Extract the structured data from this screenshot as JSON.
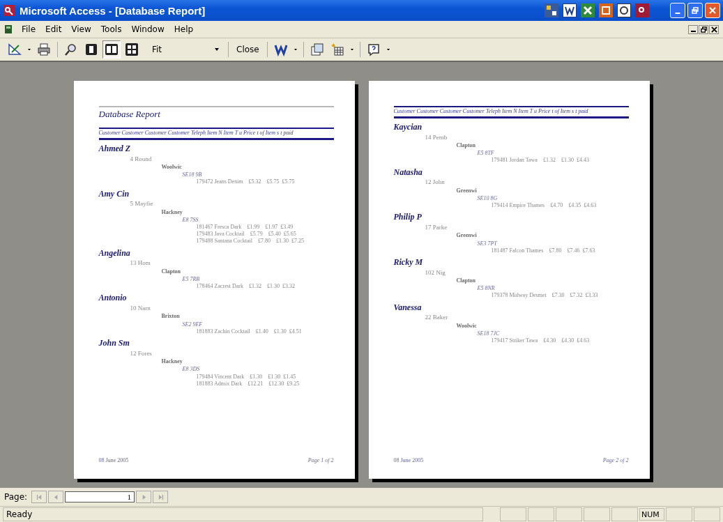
{
  "window": {
    "title": "Microsoft Access - [Database Report]"
  },
  "menu": [
    {
      "label": "File"
    },
    {
      "label": "Edit"
    },
    {
      "label": "View"
    },
    {
      "label": "Tools"
    },
    {
      "label": "Window"
    },
    {
      "label": "Help"
    }
  ],
  "toolbar": {
    "zoom": "Fit",
    "close": "Close"
  },
  "pages": [
    {
      "title": "Database Report",
      "header": "Customer  Customer  Customer  Customer  Teleph  Item N  Item T  u Price  t of Item s t paid",
      "customers": [
        {
          "name": "Ahmed Z",
          "address": "4 Round",
          "town": "Woolwic",
          "postcode": "SE18 9B",
          "items": [
            "179472 Jeans Denim    £5.32    £5.75  £5.75"
          ]
        },
        {
          "name": "Amy Cin",
          "address": "5 Mayfie",
          "town": "Hackney",
          "postcode": "E8 7SS",
          "items": [
            "181467 Fresca Dark    £1.99    £1.97  £3.49",
            "179483 Java Cocktail    £5.79    £5.40  £5.65",
            "179488 Santana Cocktail    £7.80    £1.30  £7.25"
          ]
        },
        {
          "name": "Angelina",
          "address": "13 Hom",
          "town": "Clapton",
          "postcode": "E5 7RB",
          "items": [
            "178464 Zacrest Dark    £1.32    £1.30  £3.32"
          ]
        },
        {
          "name": "Antonio",
          "address": "10 Narn",
          "town": "Brixton",
          "postcode": "SE2 9EF",
          "items": [
            "181883 Zachin Cocktail    £1.40    £1.30  £4.51"
          ]
        },
        {
          "name": "John Sm",
          "address": "12 Fores",
          "town": "Hackney",
          "postcode": "E8 3DS",
          "items": [
            "179484 Vincent Dark    £1.30    £1.30  £1.45",
            "181883 Admix Dark    £12.21    £12.30  £9.25"
          ]
        }
      ],
      "date": "08 June 2005",
      "page_number": "Page 1 of 2"
    },
    {
      "header": "Customer  Customer  Customer  Customer  Teleph  Item N  Item T  u Price  t of Item s t paid",
      "customers": [
        {
          "name": "Kaycian",
          "address": "14 Pemb",
          "town": "Clapton",
          "postcode": "E5 8TF",
          "items": [
            "179481 Jordan Tawa    £1.32    £1.30  £4.43"
          ]
        },
        {
          "name": "Natasha",
          "address": "12 John",
          "town": "Greenwi",
          "postcode": "SE10 8G",
          "items": [
            "179414 Empire Thames    £4.70    £4.35  £4.63"
          ]
        },
        {
          "name": "Philip P",
          "address": "17 Parke",
          "town": "Greenwi",
          "postcode": "SE3 7PT",
          "items": [
            "181487 Falcon Thames    £7.80    £7.46  £7.63"
          ]
        },
        {
          "name": "Ricky M",
          "address": "102 Nig",
          "town": "Clapton",
          "postcode": "E5 8NR",
          "items": [
            "179378 Midway Desmet    £7.30    £7.32  £3.33"
          ]
        },
        {
          "name": "Vanessa",
          "address": "22 Baker",
          "town": "Woolwic",
          "postcode": "SE18 7JC",
          "items": [
            "179417 Striker Tawa    £4.30    £4.30  £4.63"
          ]
        }
      ],
      "date": "08 June 2005",
      "page_number": "Page 2 of 2"
    }
  ],
  "navigation": {
    "label": "Page:",
    "value": "1"
  },
  "status_bar": {
    "text": "Ready",
    "indicator": "NUM"
  }
}
